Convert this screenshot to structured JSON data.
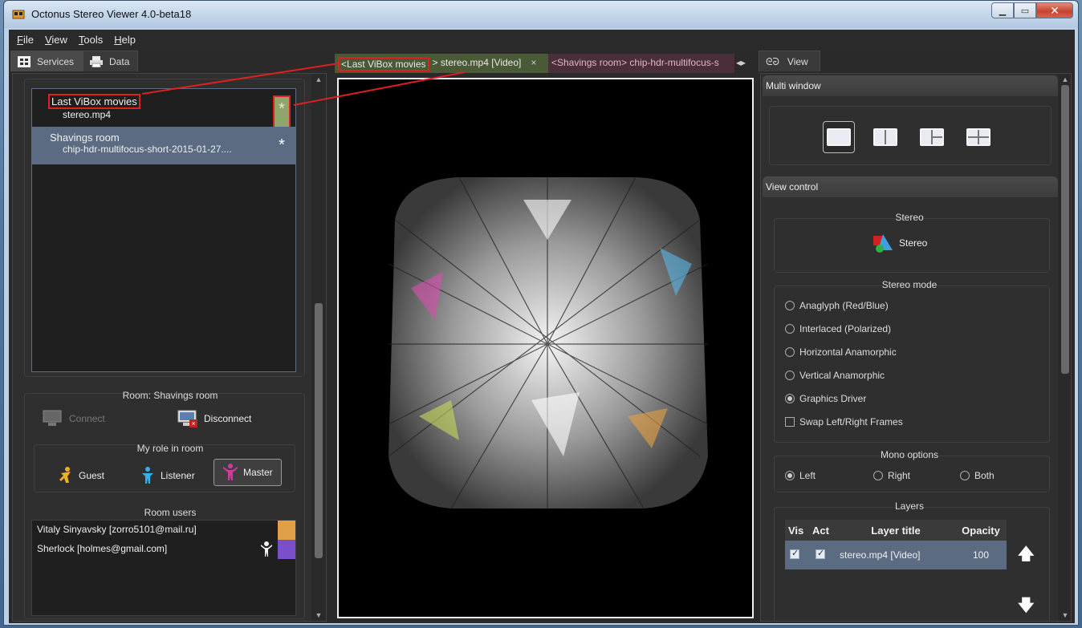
{
  "window": {
    "title": "Octonus Stereo Viewer 4.0-beta18"
  },
  "menu": [
    {
      "letter": "F",
      "rest": "ile"
    },
    {
      "letter": "V",
      "rest": "iew"
    },
    {
      "letter": "T",
      "rest": "ools"
    },
    {
      "letter": "H",
      "rest": "elp"
    }
  ],
  "left_tabs": {
    "services": "Services",
    "data": "Data"
  },
  "rooms": [
    {
      "name": "Last ViBox movies",
      "file": "stereo.mp4",
      "star": "*"
    },
    {
      "name": "Shavings room",
      "file": "chip-hdr-multifocus-short-2015-01-27....",
      "star": "*"
    }
  ],
  "room_controls": {
    "room_label": "Room: Shavings room",
    "connect": "Connect",
    "disconnect": "Disconnect",
    "role_label": "My role in room",
    "guest": "Guest",
    "listener": "Listener",
    "master": "Master",
    "users_label": "Room users"
  },
  "room_users": [
    {
      "name": "Vitaly Sinyavsky [zorro5101@mail.ru]",
      "color": "#e0a04a"
    },
    {
      "name": "Sherlock [holmes@gmail.com]",
      "color": "#7b4fc9"
    }
  ],
  "center_tabs": [
    {
      "prefix": "<",
      "room": "Last ViBox movies",
      "suffix": "> stereo.mp4 [Video]",
      "close": "×"
    },
    {
      "label": "<Shavings room> chip-hdr-multifocus-s"
    }
  ],
  "right_tab": {
    "label": "View"
  },
  "multi_window": {
    "header": "Multi window"
  },
  "view_control": {
    "header": "View control",
    "stereo_group": "Stereo",
    "stereo_button": "Stereo",
    "stereo_mode_group": "Stereo mode",
    "stereo_modes": [
      {
        "label": "Anaglyph (Red/Blue)",
        "checked": false
      },
      {
        "label": "Interlaced (Polarized)",
        "checked": false
      },
      {
        "label": "Horizontal Anamorphic",
        "checked": false
      },
      {
        "label": "Vertical Anamorphic",
        "checked": false
      },
      {
        "label": "Graphics Driver",
        "checked": true
      }
    ],
    "swap_frames": "Swap Left/Right Frames",
    "mono_group": "Mono options",
    "mono_options": [
      {
        "label": "Left",
        "checked": true
      },
      {
        "label": "Right",
        "checked": false
      },
      {
        "label": "Both",
        "checked": false
      }
    ],
    "layers_group": "Layers"
  },
  "layers_table": {
    "columns": [
      "Vis",
      "Act",
      "Layer title",
      "Opacity"
    ],
    "rows": [
      {
        "vis": true,
        "act": true,
        "title": "stereo.mp4 [Video]",
        "opacity": "100"
      }
    ]
  },
  "colors": {
    "accent_highlight": "#e02020",
    "selection": "#5a6b82",
    "tab_active_room": "#4a5a36"
  }
}
